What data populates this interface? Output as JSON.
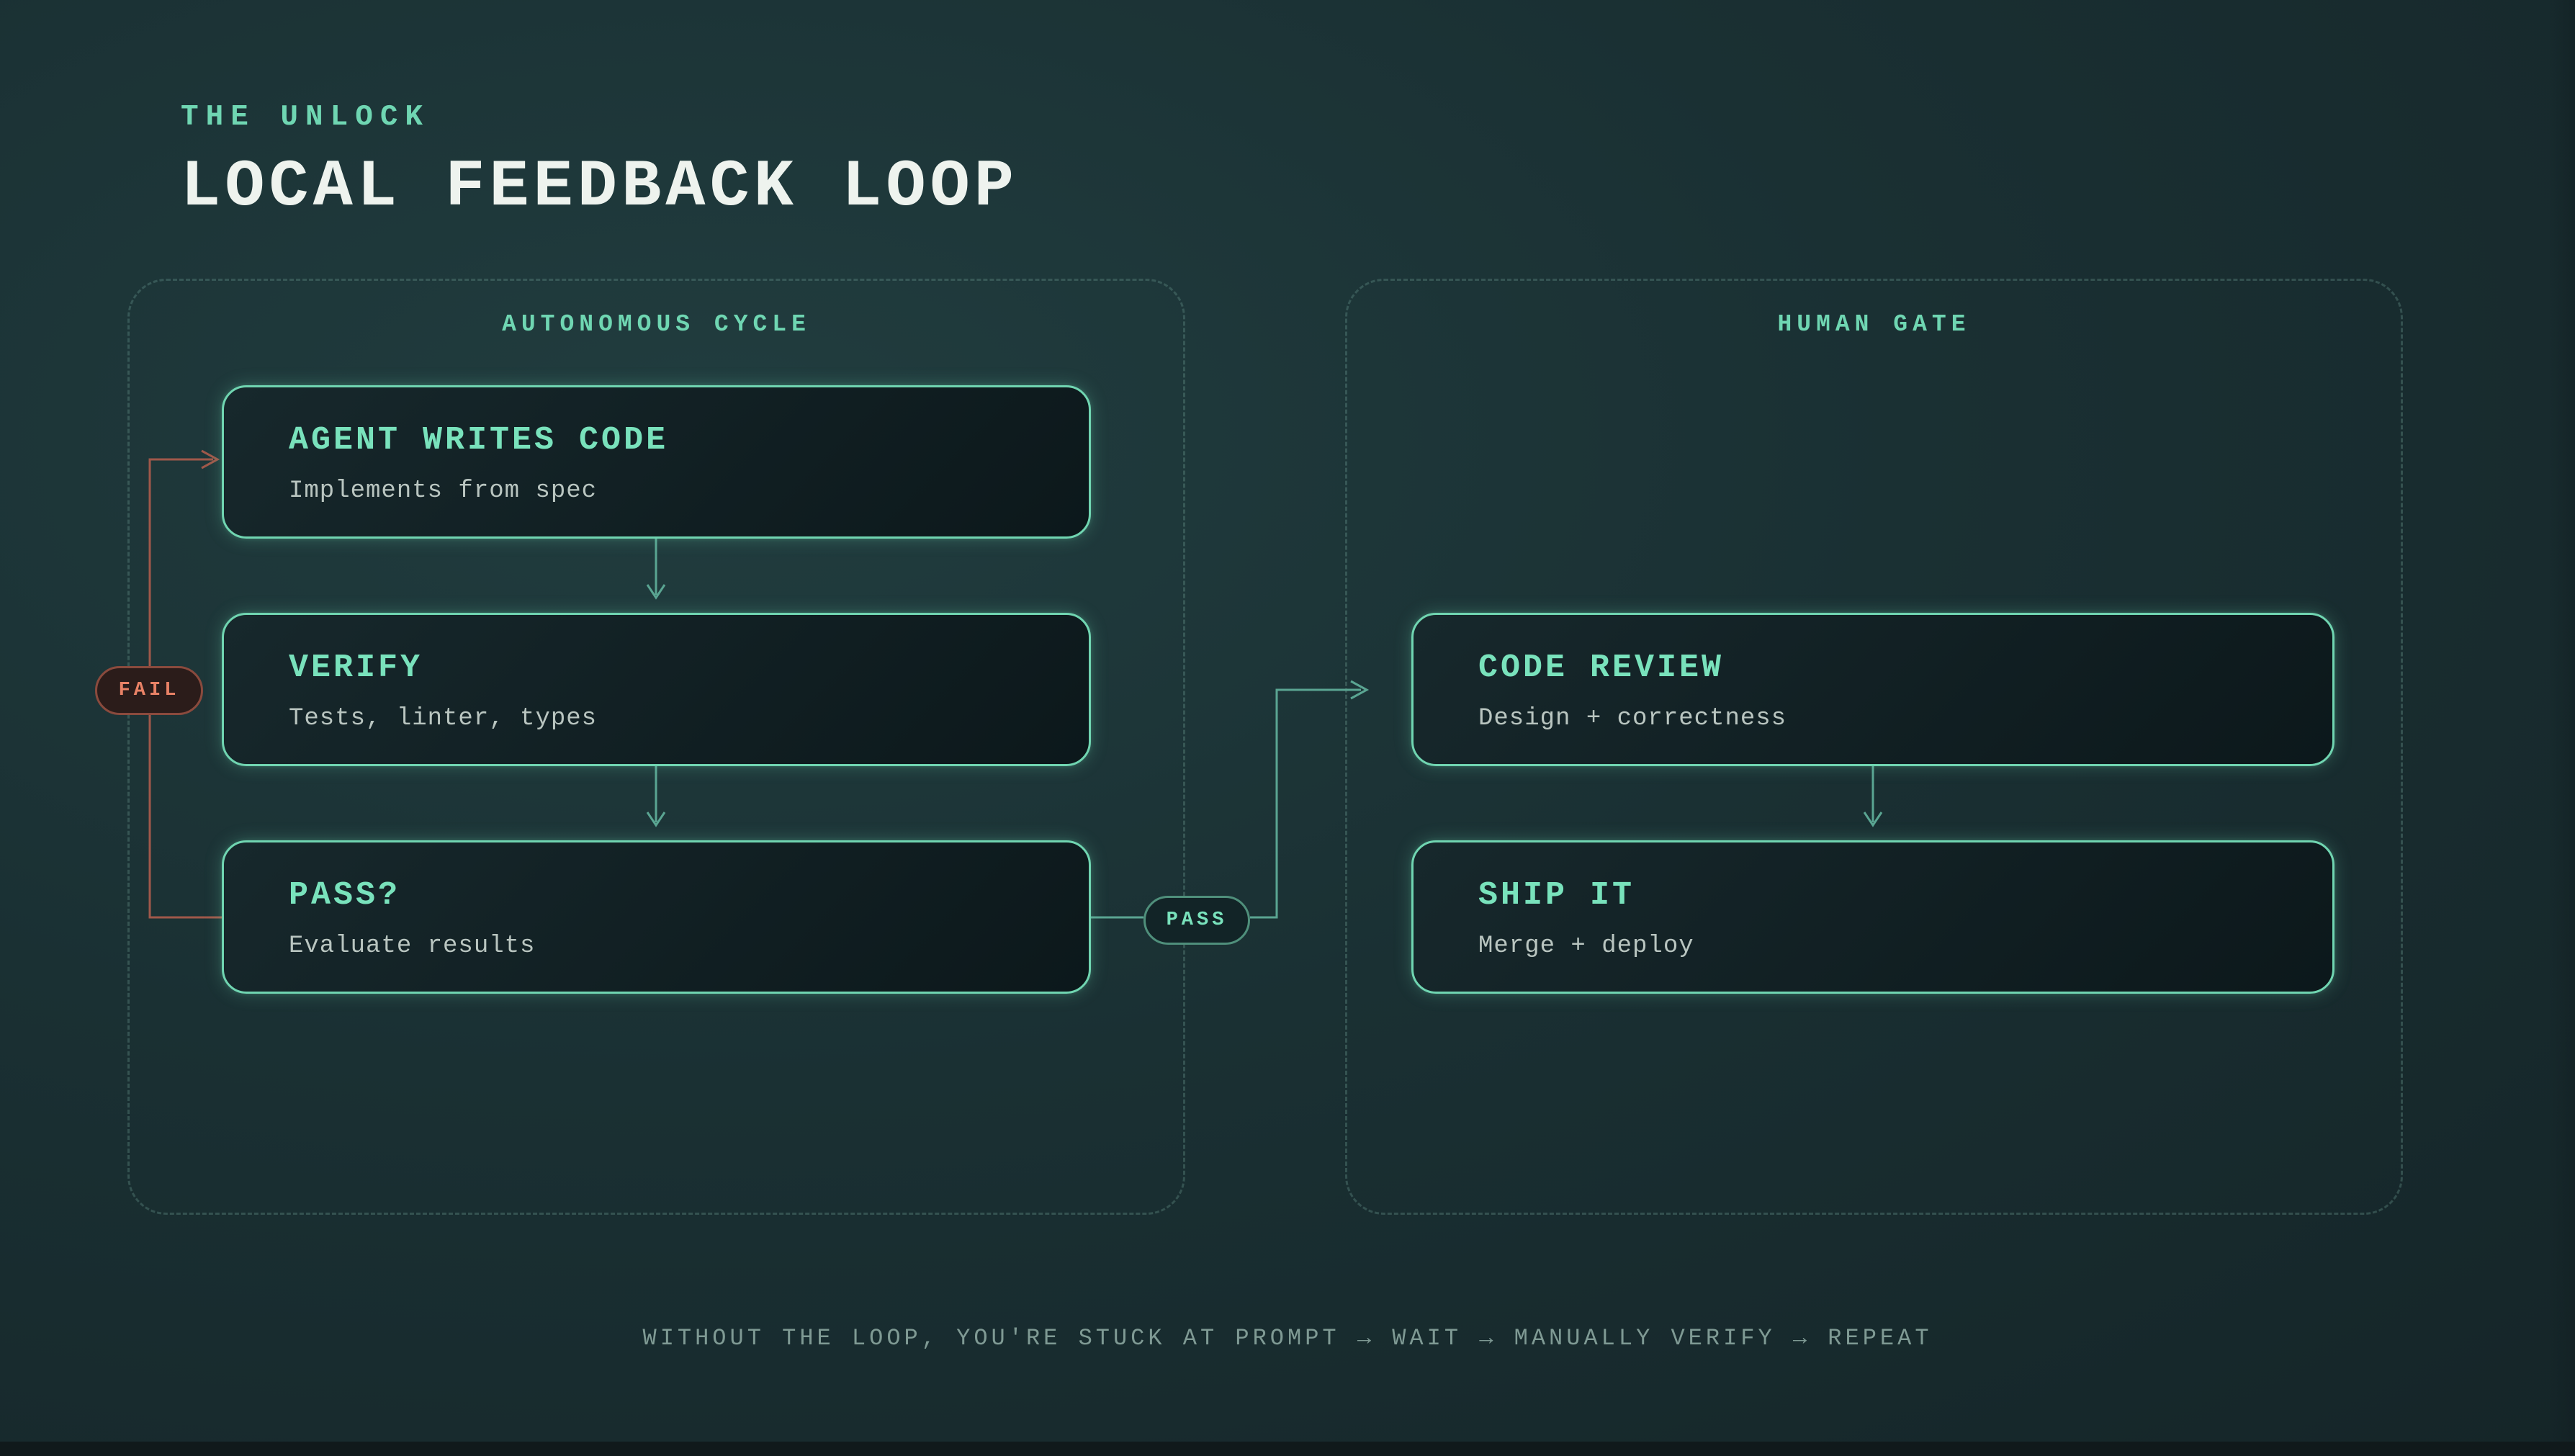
{
  "header": {
    "eyebrow": "THE UNLOCK",
    "title": "LOCAL FEEDBACK LOOP"
  },
  "groups": {
    "left_label": "AUTONOMOUS CYCLE",
    "right_label": "HUMAN GATE"
  },
  "nodes": {
    "agent": {
      "title": "AGENT WRITES CODE",
      "subtitle": "Implements from spec"
    },
    "verify": {
      "title": "VERIFY",
      "subtitle": "Tests, linter, types"
    },
    "pass": {
      "title": "PASS?",
      "subtitle": "Evaluate results"
    },
    "review": {
      "title": "CODE REVIEW",
      "subtitle": "Design + correctness"
    },
    "ship": {
      "title": "SHIP IT",
      "subtitle": "Merge + deploy"
    }
  },
  "edges": {
    "fail_label": "FAIL",
    "pass_label": "PASS"
  },
  "footer": {
    "text": "WITHOUT THE LOOP, YOU'RE STUCK AT PROMPT → WAIT → MANUALLY VERIFY → REPEAT"
  },
  "colors": {
    "accent": "#70d5b1",
    "fail": "#d2705a",
    "text": "#eef3ee",
    "background": "#1a3033"
  }
}
